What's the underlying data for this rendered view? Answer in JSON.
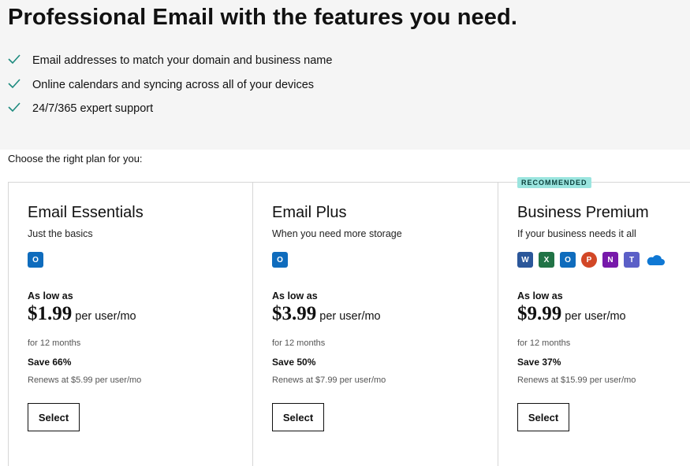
{
  "headline": "Professional Email with the features you need.",
  "features": [
    "Email addresses to match your domain and business name",
    "Online calendars and syncing across all of your devices",
    "24/7/365 expert support"
  ],
  "choose_text": "Choose the right plan for you:",
  "plans": [
    {
      "name": "Email Essentials",
      "subtitle": "Just the basics",
      "as_low_as": "As low as",
      "price": "$1.99",
      "per": "per user/mo",
      "term": "for 12 months",
      "save": "Save 66%",
      "renews": "Renews at $5.99 per user/mo",
      "select_label": "Select",
      "icons": [
        "outlook-icon"
      ]
    },
    {
      "name": "Email Plus",
      "subtitle": "When you need more storage",
      "as_low_as": "As low as",
      "price": "$3.99",
      "per": "per user/mo",
      "term": "for 12 months",
      "save": "Save 50%",
      "renews": "Renews at $7.99 per user/mo",
      "select_label": "Select",
      "icons": [
        "outlook-icon"
      ]
    },
    {
      "badge": "RECOMMENDED",
      "name": "Business Premium",
      "subtitle": "If your business needs it all",
      "as_low_as": "As low as",
      "price": "$9.99",
      "per": "per user/mo",
      "term": "for 12 months",
      "save": "Save 37%",
      "renews": "Renews at $15.99 per user/mo",
      "select_label": "Select",
      "icons": [
        "word-icon",
        "excel-icon",
        "outlook-icon",
        "powerpoint-icon",
        "onenote-icon",
        "teams-icon",
        "onedrive-icon"
      ]
    }
  ],
  "colors": {
    "check": "#1c8a7e",
    "badge_bg": "#9be5df",
    "word": "#2b579a",
    "excel": "#217346",
    "outlook": "#0f6cbd",
    "powerpoint": "#d24726",
    "onenote": "#7719aa",
    "teams": "#5b5fc7",
    "onedrive": "#0f78d4"
  }
}
